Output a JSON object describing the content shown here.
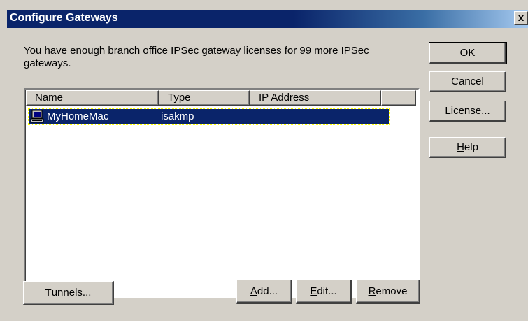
{
  "dialog": {
    "title": "Configure Gateways",
    "close_glyph": "x",
    "message": "You have enough branch office IPSec gateway licenses for 99 more IPSec gateways."
  },
  "buttons": {
    "ok": "OK",
    "cancel": "Cancel",
    "license_pre": "Li",
    "license_accel": "c",
    "license_post": "ense...",
    "help_accel": "H",
    "help_post": "elp",
    "tunnels_accel": "T",
    "tunnels_post": "unnels...",
    "add_accel": "A",
    "add_post": "dd...",
    "edit_accel": "E",
    "edit_post": "dit...",
    "remove_accel": "R",
    "remove_post": "emove"
  },
  "list": {
    "columns": [
      "Name",
      "Type",
      "IP Address"
    ],
    "rows": [
      {
        "name": "MyHomeMac",
        "type": "isakmp",
        "ip": "",
        "icon": "computer-icon",
        "selected": true
      }
    ]
  },
  "colors": {
    "titlebar": "#0a246a",
    "face": "#d4d0c8",
    "selection": "#0a246a"
  }
}
